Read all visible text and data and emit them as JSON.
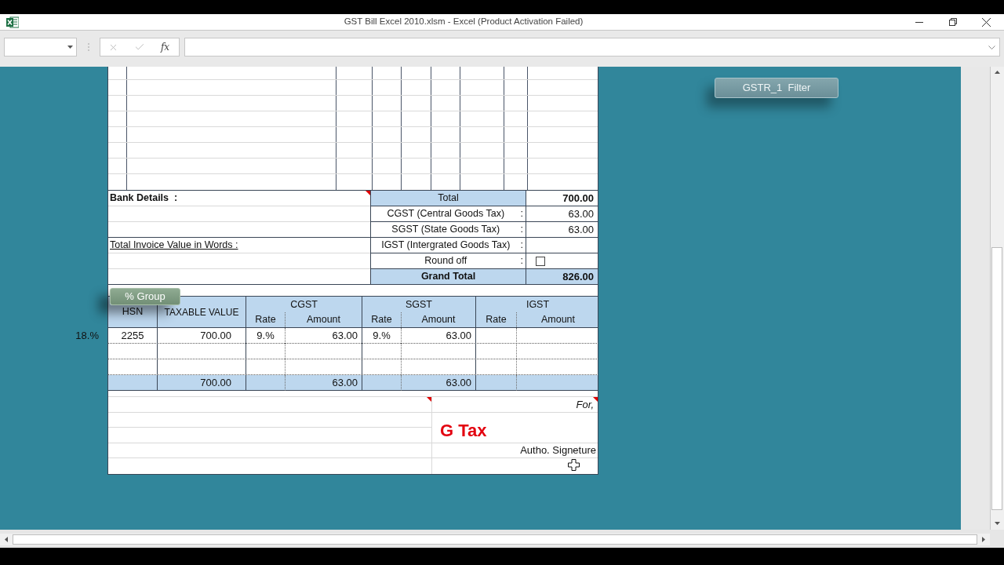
{
  "window": {
    "title": "GST Bill Excel 2010.xlsm - Excel (Product Activation Failed)"
  },
  "formula_bar": {
    "buttons": [
      {
        "kind": "cancel",
        "disabled": true
      },
      {
        "kind": "enter",
        "disabled": true
      },
      {
        "kind": "function",
        "label": "fx",
        "disabled": false
      }
    ]
  },
  "sheet": {
    "filter_button": {
      "label": "GSTR_1  Filter"
    },
    "summary": {
      "bank_details": "Bank Details  :",
      "amount_in_words": "Total Invoice Value in Words :",
      "rows": [
        {
          "kind": "subtotal",
          "label": "Total",
          "value": "700.00"
        },
        {
          "kind": "tax",
          "label": "CGST (Central Goods Tax)",
          "separator": ":",
          "value": "63.00"
        },
        {
          "kind": "tax",
          "label": "SGST (State Goods Tax)",
          "separator": ":",
          "value": "63.00"
        },
        {
          "kind": "tax",
          "label": "IGST (Intergrated Goods Tax)",
          "separator": ":"
        },
        {
          "kind": "checkbox",
          "label": "Round off",
          "separator": ":",
          "checked": false
        },
        {
          "kind": "grand_total",
          "label": "Grand Total",
          "value": "826.00"
        }
      ]
    },
    "tax_table": {
      "group_button": {
        "label": "% Group"
      },
      "columns": [
        "HSN",
        "TAXABLE VALUE"
      ],
      "groups": [
        {
          "label": "CGST",
          "sub_columns": [
            "Rate",
            "Amount"
          ]
        },
        {
          "label": "SGST",
          "sub_columns": [
            "Rate",
            "Amount"
          ]
        },
        {
          "label": "IGST",
          "sub_columns": [
            "Rate",
            "Amount"
          ]
        }
      ],
      "rows": [
        {
          "kind": "item",
          "side_label": "18.%",
          "cells": [
            "2255",
            "700.00",
            "9.%",
            "63.00",
            "9.%",
            "63.00",
            null,
            null
          ]
        },
        {
          "kind": "blank"
        },
        {
          "kind": "blank"
        },
        {
          "kind": "total",
          "cells": [
            null,
            "700.00",
            null,
            "63.00",
            null,
            "63.00",
            null,
            null
          ]
        }
      ]
    },
    "footer": {
      "for_label": "For,",
      "company": "G Tax",
      "signature": "Autho. Signeture"
    }
  }
}
